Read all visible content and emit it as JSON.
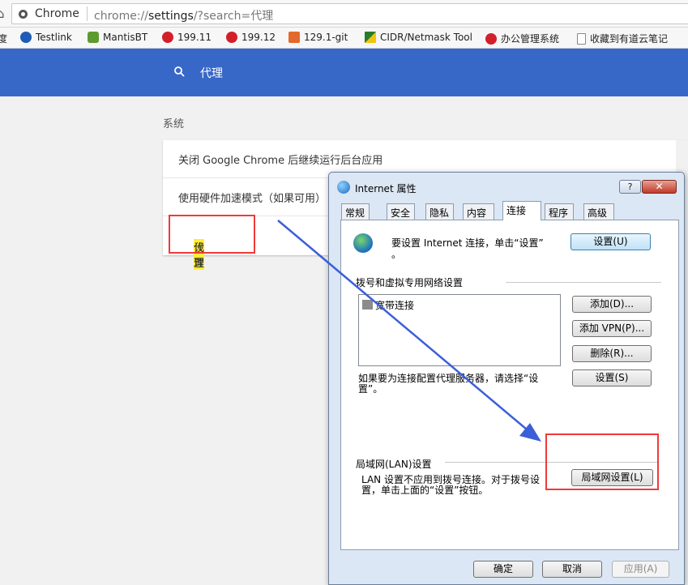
{
  "browser": {
    "app_name": "Chrome",
    "url_prefix": "chrome://",
    "url_bold": "settings",
    "url_suffix": "/?search=代理",
    "home_glyph": "⌂"
  },
  "bookmarks": [
    {
      "label": "度",
      "icon": "none"
    },
    {
      "label": "Testlink",
      "icon": "testlink-icon"
    },
    {
      "label": "MantisBT",
      "icon": "mantis-icon"
    },
    {
      "label": "199.11",
      "icon": "red-circle-icon"
    },
    {
      "label": "199.12",
      "icon": "red-circle-icon"
    },
    {
      "label": "129.1-git",
      "icon": "gitlab-icon"
    },
    {
      "label": "CIDR/Netmask Tool",
      "icon": "cidr-icon"
    },
    {
      "label": "办公管理系统",
      "icon": "red-circle-icon"
    },
    {
      "label": "收藏到有道云笔记",
      "icon": "doc-icon"
    }
  ],
  "search": {
    "query": "代理"
  },
  "settings": {
    "section_title": "系统",
    "rows": [
      {
        "label": "关闭 Google Chrome 后继续运行后台应用"
      },
      {
        "label": "使用硬件加速模式（如果可用）"
      },
      {
        "label_before": "打开",
        "label_highlight": "代理",
        "label_after": "设置"
      }
    ]
  },
  "dialog": {
    "title": "Internet 属性",
    "help_label": "?",
    "close_label": "✕",
    "tabs": [
      "常规",
      "安全",
      "隐私",
      "内容",
      "连接",
      "程序",
      "高级"
    ],
    "active_tab": "连接",
    "setup_text": "要设置 Internet 连接，单击“设置”",
    "setup_text_2": "。",
    "setup_button": "设置(U)",
    "dialup_group": "拨号和虚拟专用网络设置",
    "connection_item": "宽带连接",
    "add_button": "添加(D)...",
    "add_vpn_button": "添加 VPN(P)...",
    "delete_button": "删除(R)...",
    "settings_button": "设置(S)",
    "proxy_text": "如果要为连接配置代理服务器，请选择“设",
    "proxy_text_2": "置”。",
    "lan_group": "局域网(LAN)设置",
    "lan_text_1": "LAN 设置不应用到拨号连接。对于拨号设",
    "lan_text_2": "置，单击上面的“设置”按钮。",
    "lan_button": "局域网设置(L)",
    "ok_button": "确定",
    "cancel_button": "取消",
    "apply_button": "应用(A)"
  },
  "colors": {
    "header_blue": "#3868c7",
    "highlight_yellow": "#ffee32",
    "annotation_red": "#f03a3a",
    "arrow_blue": "#3b5fd9"
  }
}
